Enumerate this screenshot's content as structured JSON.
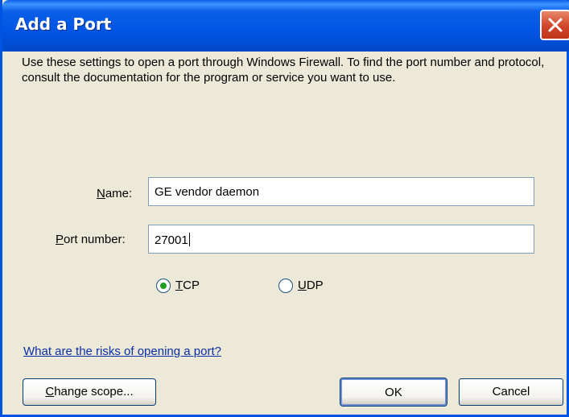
{
  "window": {
    "title": "Add a Port",
    "close_icon": "close-icon"
  },
  "description": "Use these settings to open a port through Windows Firewall. To find the port number and protocol, consult the documentation for the program or service you want to use.",
  "form": {
    "name": {
      "label_prefix": "",
      "label_accel": "N",
      "label_rest": "ame:",
      "value": "GE vendor daemon"
    },
    "port": {
      "label_accel": "P",
      "label_rest": "ort number:",
      "value": "27001"
    }
  },
  "protocol": {
    "options": [
      {
        "accel": "T",
        "rest": "CP",
        "selected": true
      },
      {
        "accel": "U",
        "rest": "DP",
        "selected": false
      }
    ]
  },
  "risks_link": "What are the risks of opening a port?",
  "buttons": {
    "change_scope": {
      "accel": "C",
      "rest": "hange scope..."
    },
    "ok": "OK",
    "cancel": "Cancel"
  },
  "colors": {
    "title_bar": "#0055e5",
    "dialog_bg": "#ece9d8",
    "radio_dot": "#21a121",
    "link": "#0a2ea8",
    "close_button": "#d0452a"
  }
}
